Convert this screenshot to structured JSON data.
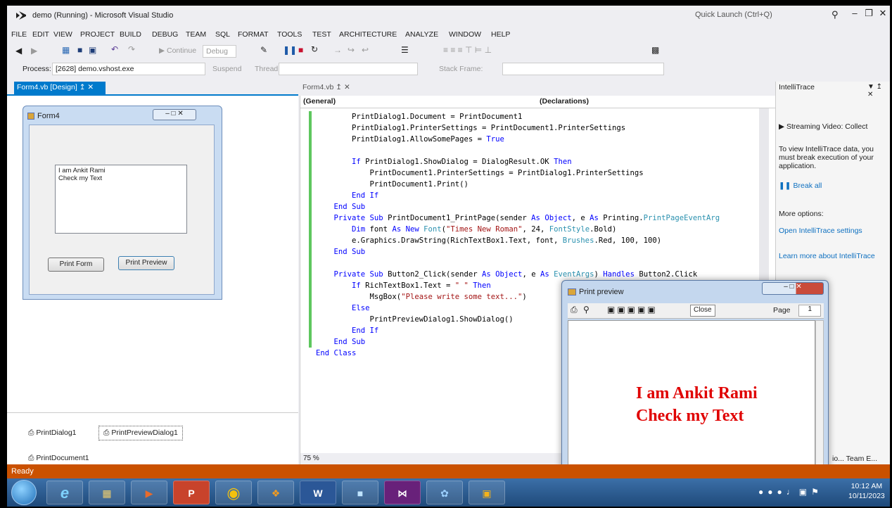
{
  "window": {
    "title": "demo (Running) - Microsoft Visual Studio",
    "quick_launch_placeholder": "Quick Launch (Ctrl+Q)"
  },
  "menu": [
    "FILE",
    "EDIT",
    "VIEW",
    "PROJECT",
    "BUILD",
    "DEBUG",
    "TEAM",
    "SQL",
    "FORMAT",
    "TOOLS",
    "TEST",
    "ARCHITECTURE",
    "ANALYZE",
    "WINDOW",
    "HELP"
  ],
  "toolbar": {
    "continue_label": "Continue",
    "config_value": "Debug",
    "process_label": "Process:",
    "process_value": "[2628] demo.vshost.exe",
    "suspend_label": "Suspend",
    "thread_label": "Thread:",
    "stack_frame_label": "Stack Frame:"
  },
  "tabs": {
    "designer": "Form4.vb [Design]",
    "code": "Form4.vb"
  },
  "designer": {
    "form_title": "Form4",
    "richtext_lines": [
      "I am Ankit Rami",
      "Check my Text"
    ],
    "print_form_button": "Print Form",
    "print_preview_button": "Print Preview",
    "tray": [
      "PrintDialog1",
      "PrintPreviewDialog1",
      "PrintDocument1"
    ]
  },
  "editor": {
    "nav_left": "(General)",
    "nav_right": "(Declarations)",
    "zoom": "75 %"
  },
  "intellitrace": {
    "title": "IntelliTrace",
    "streaming": "Streaming Video: Collect",
    "info": "To view IntelliTrace data, you must break execution of your application.",
    "break_all": "Break all",
    "more_options": "More options:",
    "open_settings": "Open IntelliTrace settings",
    "learn_more": "Learn more about IntelliTrace",
    "bottom_tabs": "io...  Team E..."
  },
  "print_preview": {
    "title": "Print preview",
    "close_label": "Close",
    "page_label": "Page",
    "page_value": "1",
    "lines": [
      "I am Ankit Rami",
      "Check my Text"
    ]
  },
  "status": "Ready",
  "clock": {
    "time": "10:12 AM",
    "date": "10/11/2023"
  }
}
